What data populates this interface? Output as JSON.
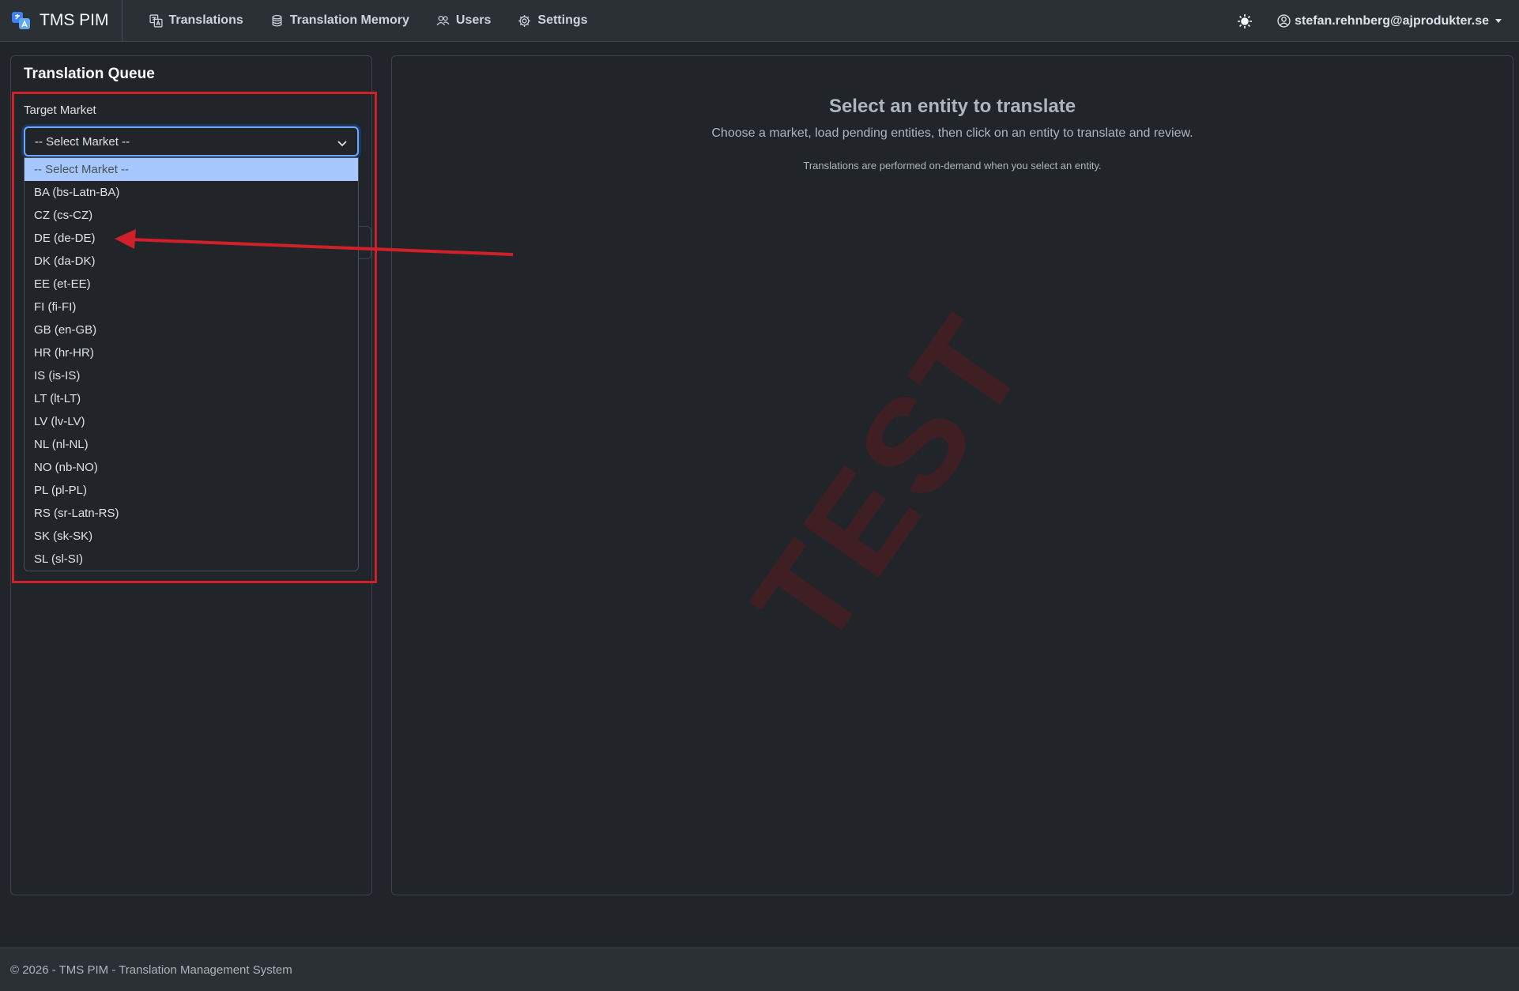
{
  "navbar": {
    "brand": "TMS PIM",
    "items": [
      {
        "label": "Translations",
        "icon": "translate-icon"
      },
      {
        "label": "Translation Memory",
        "icon": "database-icon"
      },
      {
        "label": "Users",
        "icon": "users-icon"
      },
      {
        "label": "Settings",
        "icon": "gear-icon"
      }
    ],
    "user": "stefan.rehnberg@ajprodukter.se"
  },
  "left_panel": {
    "title": "Translation Queue",
    "target_market_label": "Target Market",
    "select_value": "-- Select Market --",
    "options": [
      "-- Select Market --",
      "BA (bs-Latn-BA)",
      "CZ (cs-CZ)",
      "DE (de-DE)",
      "DK (da-DK)",
      "EE (et-EE)",
      "FI (fi-FI)",
      "GB (en-GB)",
      "HR (hr-HR)",
      "IS (is-IS)",
      "LT (lt-LT)",
      "LV (lv-LV)",
      "NL (nl-NL)",
      "NO (nb-NO)",
      "PL (pl-PL)",
      "RS (sr-Latn-RS)",
      "SK (sk-SK)",
      "SL (sl-SI)"
    ]
  },
  "main": {
    "empty_title": "Select an entity to translate",
    "empty_description": "Choose a market, load pending entities, then click on an entity to translate and review.",
    "empty_note": "Translations are performed on-demand when you select an entity.",
    "watermark": "TEST"
  },
  "footer": {
    "text": "© 2026 - TMS PIM - Translation Management System"
  },
  "colors": {
    "annotation": "#d0202a",
    "selected_option": "#a6c8ff",
    "focus_border": "#6ea8fe"
  }
}
